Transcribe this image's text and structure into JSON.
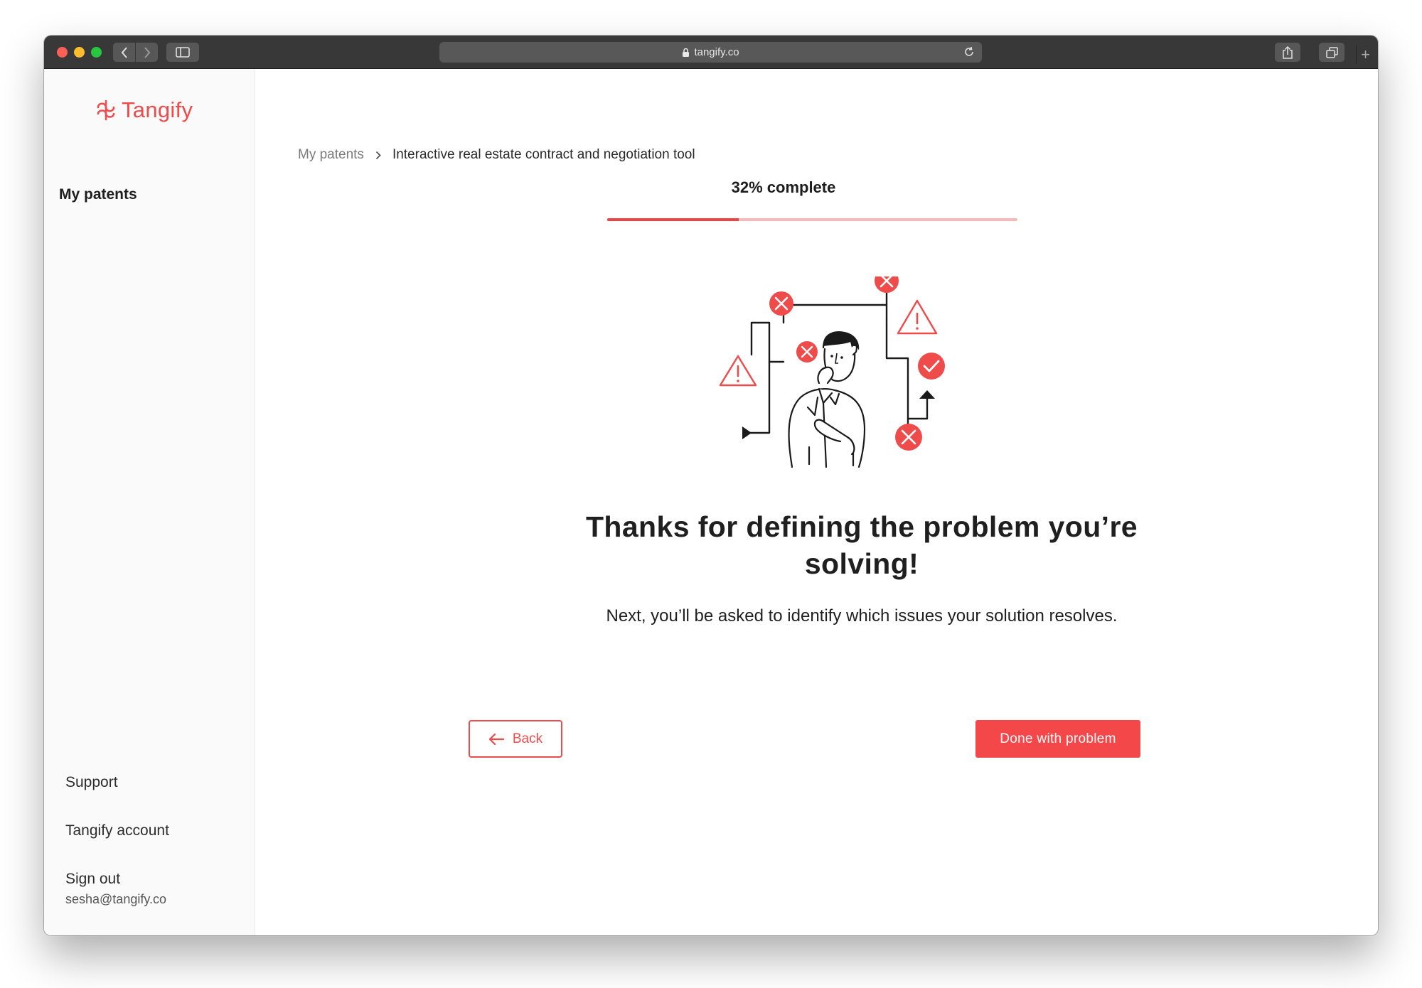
{
  "browser": {
    "url": "tangify.co"
  },
  "sidebar": {
    "logo_text": "Tangify",
    "primary_item": "My patents",
    "bottom_items": [
      "Support",
      "Tangify account",
      "Sign out"
    ],
    "user_email": "sesha@tangify.co"
  },
  "breadcrumb": {
    "root": "My patents",
    "current": "Interactive real estate contract and negotiation tool"
  },
  "progress": {
    "label": "32% complete",
    "value_percent": 32
  },
  "main": {
    "headline": "Thanks for defining the problem you’re solving!",
    "subtext": "Next, you’ll be asked to identify which issues your solution resolves."
  },
  "actions": {
    "back_label": "Back",
    "done_label": "Done with problem"
  },
  "colors": {
    "accent": "#f04b4b",
    "progress_track": "#f8b9b9"
  }
}
